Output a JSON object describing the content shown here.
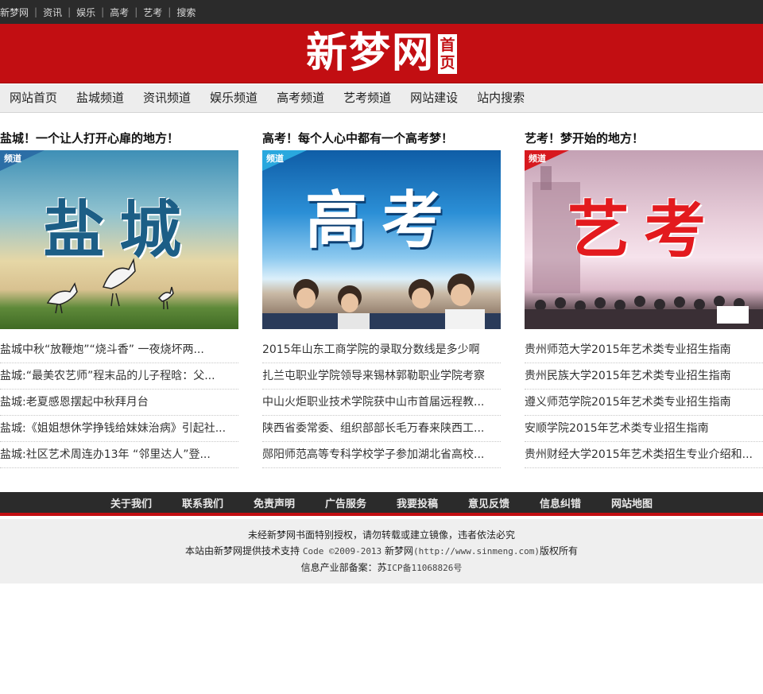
{
  "topbar": {
    "links": [
      "新梦网",
      "资讯",
      "娱乐",
      "高考",
      "艺考",
      "搜索"
    ]
  },
  "header": {
    "logo_text": "新梦网",
    "badge_top": "首",
    "badge_bottom": "页"
  },
  "nav": {
    "items": [
      "网站首页",
      "盐城频道",
      "资讯频道",
      "娱乐频道",
      "高考频道",
      "艺考频道",
      "网站建设",
      "站内搜索"
    ]
  },
  "columns": [
    {
      "title": "盐城！一个让人打开心扉的地方！",
      "ribbon": "频道",
      "banner_text": "盐城",
      "items": [
        "盐城中秋“放鞭炮”“烧斗香” 一夜烧坏两...",
        "盐城:“最美农艺师”程末品的儿子程晗：父...",
        "盐城:老夏感恩摆起中秋拜月台",
        "盐城:《姐姐想休学挣钱给妹妹治病》引起社...",
        "盐城:社区艺术周连办13年 “邻里达人”登..."
      ]
    },
    {
      "title": "高考！每个人心中都有一个高考梦！",
      "ribbon": "频道",
      "banner_text": "高考",
      "items": [
        "2015年山东工商学院的录取分数线是多少啊",
        "扎兰屯职业学院领导来锡林郭勒职业学院考察",
        "中山火炬职业技术学院获中山市首届远程教...",
        "陕西省委常委、组织部部长毛万春来陕西工...",
        "郧阳师范高等专科学校学子参加湖北省高校..."
      ]
    },
    {
      "title": "艺考！梦开始的地方！",
      "ribbon": "频道",
      "banner_text": "艺考",
      "items": [
        "贵州师范大学2015年艺术类专业招生指南",
        "贵州民族大学2015年艺术类专业招生指南",
        "遵义师范学院2015年艺术类专业招生指南",
        "安顺学院2015年艺术类专业招生指南",
        "贵州财经大学2015年艺术类招生专业介绍和..."
      ]
    }
  ],
  "footer": {
    "links": [
      "关于我们",
      "联系我们",
      "免责声明",
      "广告服务",
      "我要投稿",
      "意见反馈",
      "信息纠错",
      "网站地图"
    ],
    "line1": "未经新梦网书面特别授权，请勿转载或建立镜像，违者依法必究",
    "line2_prefix": "本站由新梦网提供技术支持 ",
    "line2_code": "Code ©2009-2013",
    "line2_site": " 新梦网",
    "line2_url": "(http://www.sinmeng.com)",
    "line2_suffix": "版权所有",
    "line3_prefix": "信息产业部备案：苏",
    "line3_code": "ICP备11068826号"
  },
  "colors": {
    "brand_red": "#c20e12",
    "dark_bar": "#2b2b2b",
    "ribbon_blue": "#2c6ea6",
    "ribbon_sky": "#29a8de",
    "ribbon_red": "#d7191f"
  }
}
